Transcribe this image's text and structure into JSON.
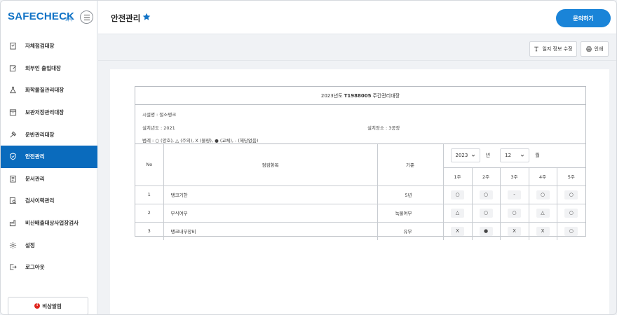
{
  "brand": {
    "logo": "SAFECHECK",
    "logo_sub": "화학"
  },
  "sidebar": {
    "items": [
      {
        "label": "자체점검대장",
        "icon": "checklist-icon",
        "active": false
      },
      {
        "label": "외부인 출입대장",
        "icon": "edit-icon",
        "active": false
      },
      {
        "label": "화학물질관리대장",
        "icon": "flask-icon",
        "active": false
      },
      {
        "label": "보관저장관리대장",
        "icon": "storage-box-icon",
        "active": false
      },
      {
        "label": "운반관리대장",
        "icon": "transport-icon",
        "active": false
      },
      {
        "label": "안전관리",
        "icon": "shield-icon",
        "active": true
      },
      {
        "label": "문서관리",
        "icon": "document-icon",
        "active": false
      },
      {
        "label": "검사이력관리",
        "icon": "inspection-history-icon",
        "active": false
      },
      {
        "label": "비산배출대상사업장검사",
        "icon": "factory-icon",
        "active": false
      },
      {
        "label": "설정",
        "icon": "gear-icon",
        "active": false
      },
      {
        "label": "로그아웃",
        "icon": "logout-icon",
        "active": false
      }
    ],
    "emergency_label": "비상알림"
  },
  "header": {
    "title": "안전관리",
    "contact_label": "문의하기"
  },
  "toolbar": {
    "edit_label": "일지 정보 수정",
    "print_label": "인쇄"
  },
  "doc": {
    "title_prefix": "2023년도",
    "title_code": "T1988005",
    "title_suffix": "주간관리대장",
    "facility": "시설명 : 절소탱크",
    "install_year": "설치년도 : 2021",
    "install_location": "설치장소 : 3공장",
    "legend": "범례 : ○ (양호), △ (주의), X (불량), ● (교체), - (해당없음)",
    "columns": {
      "no": "No",
      "item": "점검항목",
      "criteria": "기준"
    },
    "year_select": "2023",
    "year_unit": "년",
    "month_select": "12",
    "month_unit": "월",
    "weeks": [
      "1주",
      "2주",
      "3주",
      "4주",
      "5주"
    ],
    "rows": [
      {
        "no": "1",
        "item": "탱크기한",
        "criteria": "5년",
        "marks": [
          "○",
          "○",
          "-",
          "○",
          "○"
        ]
      },
      {
        "no": "2",
        "item": "부식여부",
        "criteria": "녹물여부",
        "marks": [
          "△",
          "○",
          "○",
          "△",
          "○"
        ]
      },
      {
        "no": "3",
        "item": "탱크내부장비",
        "criteria": "유무",
        "marks": [
          "X",
          "●",
          "X",
          "X",
          "○"
        ]
      }
    ]
  },
  "colors": {
    "accent": "#0a6bbd",
    "button": "#1a84d8",
    "star": "#1173c6",
    "emergency": "#e0261e"
  }
}
